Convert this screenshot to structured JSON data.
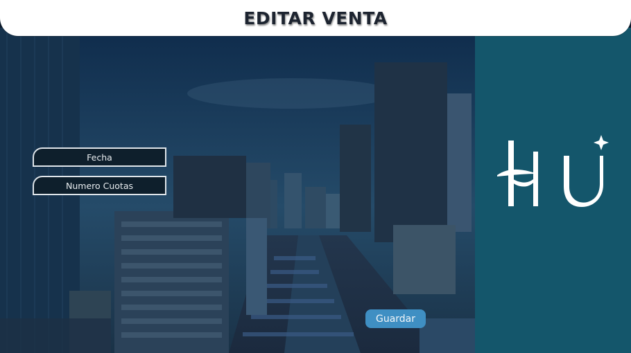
{
  "header": {
    "title": "EDITAR VENTA"
  },
  "form": {
    "fields": [
      {
        "placeholder": "Fecha"
      },
      {
        "placeholder": "Numero Cuotas"
      }
    ],
    "save_label": "Guardar"
  },
  "logo": {
    "text": "HU"
  },
  "colors": {
    "header_bg": "#ffffff",
    "title": "#1d2430",
    "side_panel": "#14566b",
    "field_bg": "#0e1f2c",
    "field_border": "#dfe5ea",
    "save_button": "#3f8fc3"
  }
}
